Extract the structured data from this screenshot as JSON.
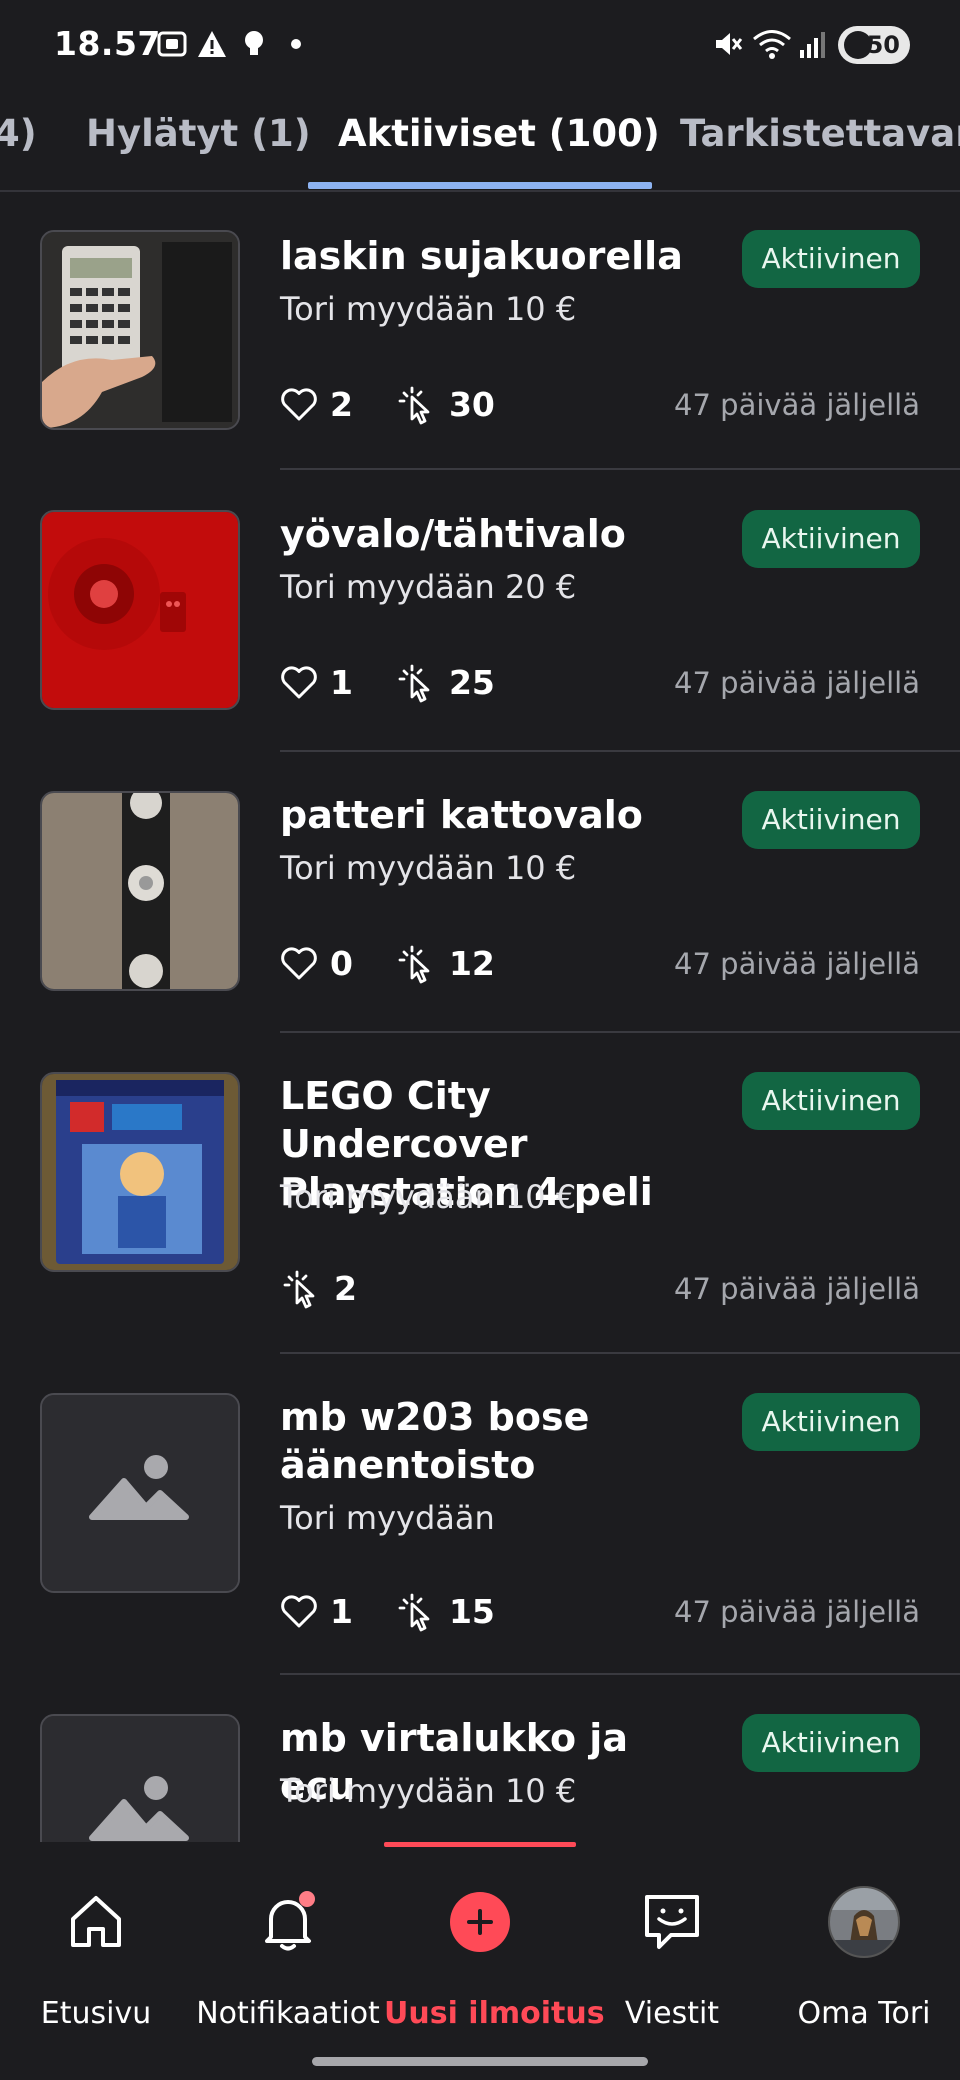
{
  "status_bar": {
    "time": "18.57",
    "battery": "50",
    "icons": [
      "screenshot-icon",
      "warning-icon",
      "bulb-icon",
      "dot-icon",
      "mute-icon",
      "wifi-icon",
      "signal-icon",
      "battery-icon"
    ]
  },
  "tabs": [
    {
      "label": "4)"
    },
    {
      "label": "Hylätyt (1)"
    },
    {
      "label": "Aktiiviset (100)",
      "active": true
    },
    {
      "label": "Tarkistettavana"
    }
  ],
  "listings": [
    {
      "title": "laskin sujakuorella",
      "subtitle": "Tori myydään 10 €",
      "status": "Aktiivinen",
      "likes": "2",
      "clicks": "30",
      "days_left": "47 päivää jäljellä"
    },
    {
      "title": "yövalo/tähtivalo",
      "subtitle": "Tori myydään 20 €",
      "status": "Aktiivinen",
      "likes": "1",
      "clicks": "25",
      "days_left": "47 päivää jäljellä"
    },
    {
      "title": "patteri kattovalo",
      "subtitle": "Tori myydään 10 €",
      "status": "Aktiivinen",
      "likes": "0",
      "clicks": "12",
      "days_left": "47 päivää jäljellä"
    },
    {
      "title": "LEGO City Undercover Playstation 4 peli",
      "subtitle": "Tori myydään 10 €",
      "status": "Aktiivinen",
      "clicks": "2",
      "days_left": "47 päivää jäljellä"
    },
    {
      "title": "mb w203 bose äänentoisto",
      "subtitle": "Tori myydään",
      "status": "Aktiivinen",
      "likes": "1",
      "clicks": "15",
      "days_left": "47 päivää jäljellä"
    },
    {
      "title": "mb virtalukko ja ecu",
      "subtitle": "Tori myydään 10 €",
      "status": "Aktiivinen"
    }
  ],
  "bottom_nav": [
    {
      "label": "Etusivu",
      "icon": "home-icon"
    },
    {
      "label": "Notifikaatiot",
      "icon": "bell-icon",
      "has_dot": true
    },
    {
      "label": "Uusi ilmoitus",
      "icon": "plus-icon",
      "active": true
    },
    {
      "label": "Viestit",
      "icon": "chat-icon"
    },
    {
      "label": "Oma Tori",
      "icon": "avatar"
    }
  ],
  "colors": {
    "background": "#1c1c1f",
    "accent_red": "#ff4a57",
    "tab_indicator": "#8db3f2",
    "badge_green": "#126643"
  }
}
